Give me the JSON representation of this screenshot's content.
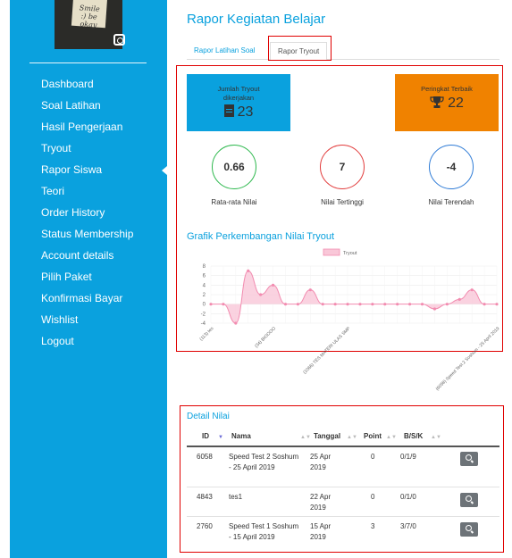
{
  "sidebar": {
    "avatar_note": "Smile :) be okay",
    "menu": [
      "Dashboard",
      "Soal Latihan",
      "Hasil Pengerjaan",
      "Tryout",
      "Rapor Siswa",
      "Teori",
      "Order History",
      "Status Membership",
      "Account details",
      "Pilih Paket",
      "Konfirmasi Bayar",
      "Wishlist",
      "Logout"
    ],
    "active_item": "Rapor Siswa"
  },
  "page": {
    "title": "Rapor Kegiatan Belajar",
    "tabs": [
      "Rapor Latihan Soal",
      "Rapor Tryout"
    ],
    "active_tab": "Rapor Tryout"
  },
  "stats": {
    "tryout_label": "Jumlah Tryout dikerjakan",
    "tryout_value": "23",
    "rank_label": "Peringkat Terbaik",
    "rank_value": "22",
    "avg_value": "0.66",
    "avg_label": "Rata-rata Nilai",
    "max_value": "7",
    "max_label": "Nilai Tertinggi",
    "min_value": "-4",
    "min_label": "Nilai Terendah"
  },
  "chart_title": "Grafik Perkembangan Nilai Tryout",
  "chart_data": {
    "type": "area",
    "legend": "Tryout",
    "ylim": [
      -4,
      8
    ],
    "yticks": [
      8,
      6,
      4,
      2,
      0,
      -2,
      -4
    ],
    "x_labels_visible": [
      "(113) tes",
      "(34) BIOOOO",
      "(1066) TES MATERI ULAS SMP",
      "(6058) Speed Test 2 Soshum - 25 April 2019"
    ],
    "values": [
      0,
      0,
      -4,
      7,
      2,
      4,
      0,
      0,
      3,
      0,
      0,
      0,
      0,
      0,
      0,
      0,
      0,
      0,
      -1,
      0,
      1,
      3,
      0,
      0
    ],
    "colors": {
      "line": "#f28cb0",
      "fill": "#f9c7d8"
    }
  },
  "detail": {
    "title": "Detail Nilai",
    "columns": [
      "ID",
      "Nama",
      "Tanggal",
      "Point",
      "B/S/K"
    ],
    "rows": [
      {
        "id": "6058",
        "nama": "Speed Test 2 Soshum - 25 April 2019",
        "tanggal": "25 Apr 2019",
        "point": "0",
        "bsk": "0/1/9"
      },
      {
        "id": "4843",
        "nama": "tes1",
        "tanggal": "22 Apr 2019",
        "point": "0",
        "bsk": "0/1/0"
      },
      {
        "id": "2760",
        "nama": "Speed Test 1 Soshum - 15 April 2019",
        "tanggal": "15 Apr 2019",
        "point": "3",
        "bsk": "3/7/0"
      }
    ]
  }
}
